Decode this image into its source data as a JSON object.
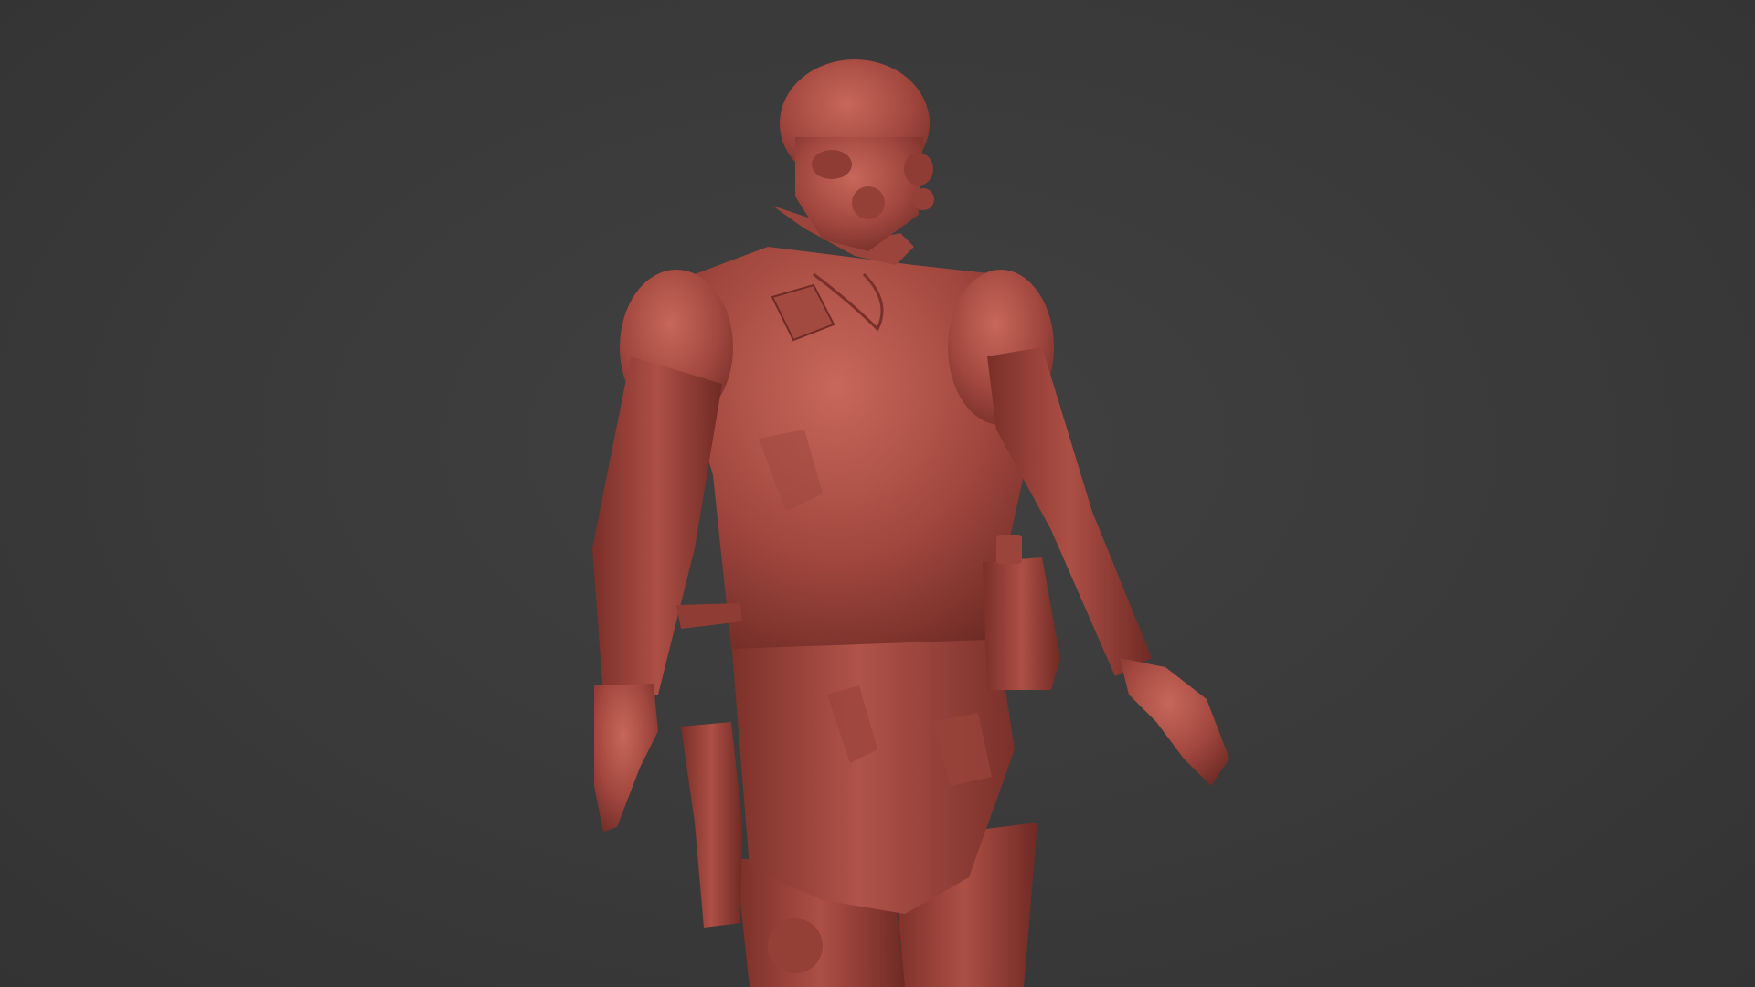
{
  "viewport": {
    "background_color": "#3a3a3a",
    "shading": "solid",
    "model": {
      "material_color": "#a3483f",
      "highlight_color": "#c8675b",
      "shadow_color": "#6e2b25"
    }
  }
}
